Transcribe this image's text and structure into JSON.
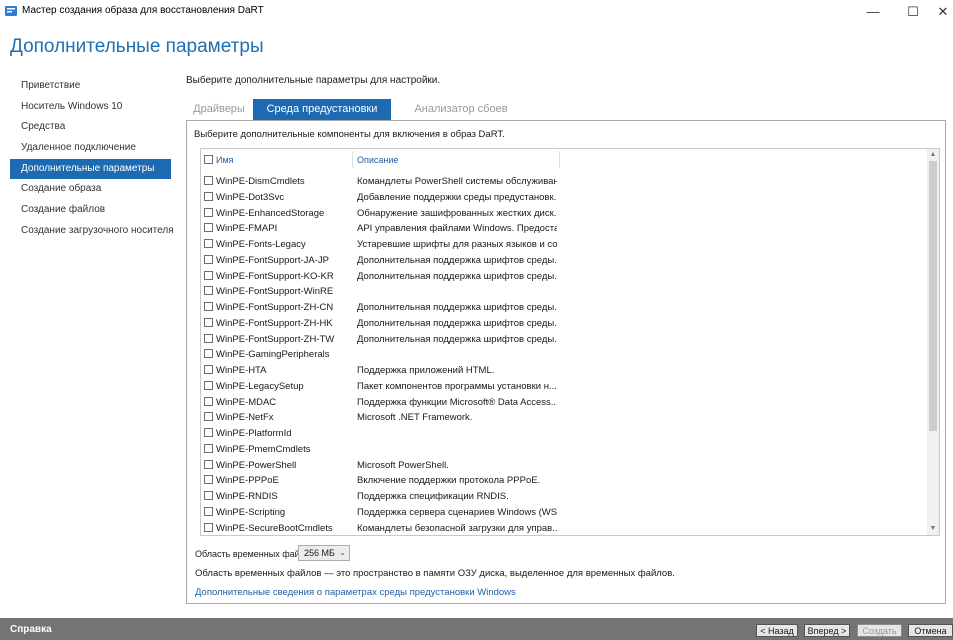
{
  "window": {
    "title": "Мастер создания образа для восстановления DaRT"
  },
  "header": {
    "title": "Дополнительные параметры"
  },
  "nav": {
    "items": [
      {
        "label": "Приветствие",
        "active": false
      },
      {
        "label": "Носитель Windows 10",
        "active": false
      },
      {
        "label": "Средства",
        "active": false
      },
      {
        "label": "Удаленное подключение",
        "active": false
      },
      {
        "label": "Дополнительные параметры",
        "active": true
      },
      {
        "label": "Создание образа",
        "active": false
      },
      {
        "label": "Создание файлов",
        "active": false
      },
      {
        "label": "Создание загрузочного носителя",
        "active": false
      }
    ]
  },
  "content": {
    "instruction": "Выберите дополнительные параметры для настройки.",
    "tabs": [
      {
        "label": "Драйверы"
      },
      {
        "label": "Среда предустановки Windows"
      },
      {
        "label": "Анализатор сбоев"
      }
    ],
    "panel_instruction": "Выберите дополнительные компоненты для включения в образ DaRT.",
    "list_headers": {
      "name": "Имя",
      "description": "Описание"
    },
    "components": [
      {
        "name": "WinPE-DismCmdlets",
        "description": "Командлеты PowerShell системы обслуживан..."
      },
      {
        "name": "WinPE-Dot3Svc",
        "description": "Добавление поддержки среды предустановк..."
      },
      {
        "name": "WinPE-EnhancedStorage",
        "description": "Обнаружение зашифрованных жестких диск..."
      },
      {
        "name": "WinPE-FMAPI",
        "description": "API управления файлами Windows. Предоста..."
      },
      {
        "name": "WinPE-Fonts-Legacy",
        "description": "Устаревшие шрифты для разных языков и со..."
      },
      {
        "name": "WinPE-FontSupport-JA-JP",
        "description": "Дополнительная поддержка шрифтов среды..."
      },
      {
        "name": "WinPE-FontSupport-KO-KR",
        "description": "Дополнительная поддержка шрифтов среды..."
      },
      {
        "name": "WinPE-FontSupport-WinRE",
        "description": ""
      },
      {
        "name": "WinPE-FontSupport-ZH-CN",
        "description": "Дополнительная поддержка шрифтов среды..."
      },
      {
        "name": "WinPE-FontSupport-ZH-HK",
        "description": "Дополнительная поддержка шрифтов среды..."
      },
      {
        "name": "WinPE-FontSupport-ZH-TW",
        "description": "Дополнительная поддержка шрифтов среды..."
      },
      {
        "name": "WinPE-GamingPeripherals",
        "description": ""
      },
      {
        "name": "WinPE-HTA",
        "description": "Поддержка приложений HTML."
      },
      {
        "name": "WinPE-LegacySetup",
        "description": "Пакет компонентов программы установки н..."
      },
      {
        "name": "WinPE-MDAC",
        "description": "Поддержка функции Microsoft® Data Access..."
      },
      {
        "name": "WinPE-NetFx",
        "description": "Microsoft .NET Framework."
      },
      {
        "name": "WinPE-PlatformId",
        "description": ""
      },
      {
        "name": "WinPE-PmemCmdlets",
        "description": ""
      },
      {
        "name": "WinPE-PowerShell",
        "description": "Microsoft PowerShell."
      },
      {
        "name": "WinPE-PPPoE",
        "description": "Включение поддержки протокола PPPoE."
      },
      {
        "name": "WinPE-RNDIS",
        "description": "Поддержка спецификации RNDIS."
      },
      {
        "name": "WinPE-Scripting",
        "description": "Поддержка сервера сценариев Windows (WS..."
      },
      {
        "name": "WinPE-SecureBootCmdlets",
        "description": "Командлеты безопасной загрузки для управ..."
      }
    ],
    "temp_files": {
      "label": "Область временных файлов:",
      "value": "256 МБ",
      "description": "Область временных файлов — это пространство в памяти ОЗУ диска, выделенное для временных файлов."
    },
    "help_link": "Дополнительные сведения о параметрах среды предустановки Windows"
  },
  "footer": {
    "help": "Справка",
    "back": "< Назад",
    "next": "Вперед >",
    "create": "Создать",
    "cancel": "Отмена"
  },
  "colors": {
    "accent": "#1d6ab3",
    "header": "#1f6fb3",
    "footer": "#747474"
  }
}
